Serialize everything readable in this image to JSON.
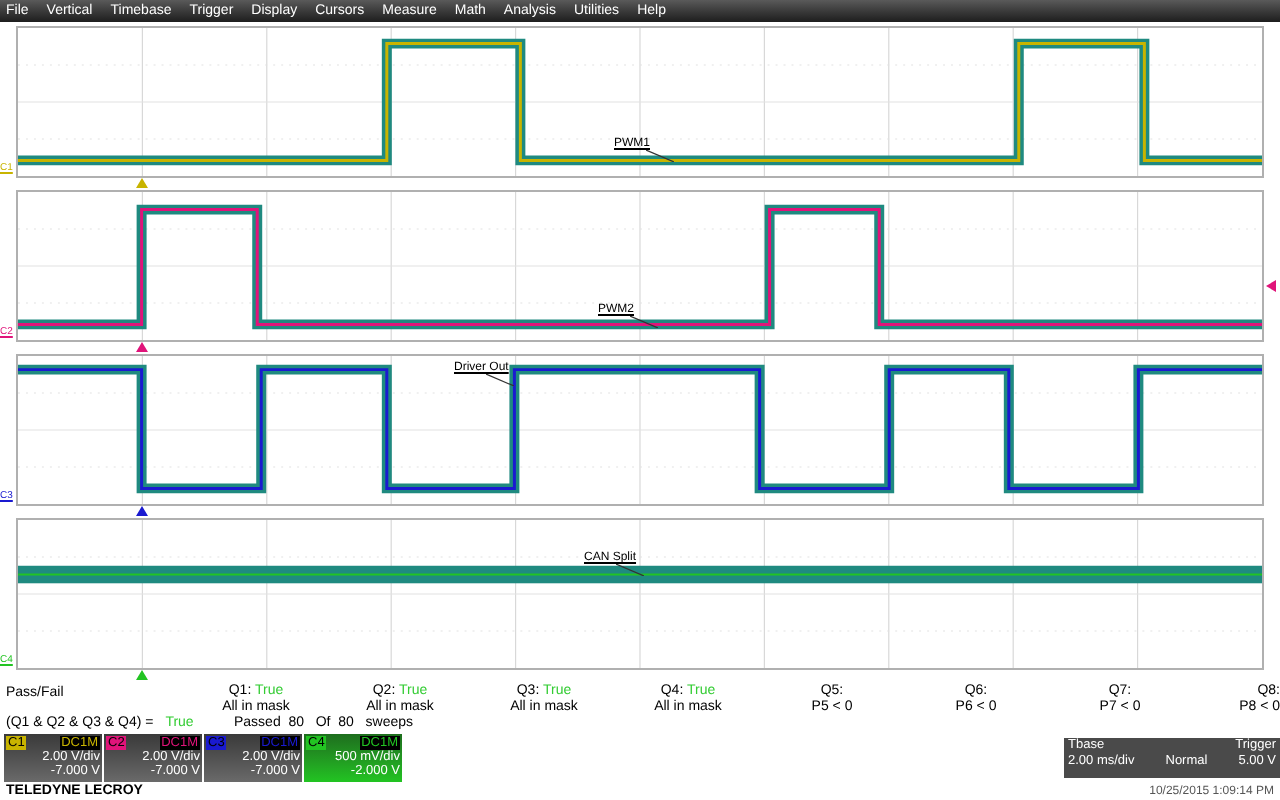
{
  "menu": [
    "File",
    "Vertical",
    "Timebase",
    "Trigger",
    "Display",
    "Cursors",
    "Measure",
    "Math",
    "Analysis",
    "Utilities",
    "Help"
  ],
  "traces": [
    {
      "marker": "C1",
      "label": "PWM1"
    },
    {
      "marker": "C2",
      "label": "PWM2"
    },
    {
      "marker": "C3",
      "label": "Driver Out"
    },
    {
      "marker": "C4",
      "label": "CAN Split"
    }
  ],
  "pass_fail": {
    "title": "Pass/Fail",
    "tests": [
      {
        "label": "Q1:",
        "result": "True",
        "detail": "All in mask"
      },
      {
        "label": "Q2:",
        "result": "True",
        "detail": "All in mask"
      },
      {
        "label": "Q3:",
        "result": "True",
        "detail": "All in mask"
      },
      {
        "label": "Q4:",
        "result": "True",
        "detail": "All in mask"
      },
      {
        "label": "Q5:",
        "detail": "P5 < 0"
      },
      {
        "label": "Q6:",
        "detail": "P6 < 0"
      },
      {
        "label": "Q7:",
        "detail": "P7 < 0"
      },
      {
        "label": "Q8:",
        "detail": "P8 < 0"
      }
    ],
    "expression": "(Q1 & Q2 & Q3 & Q4) =",
    "expression_result": "True",
    "summary": "Passed  80   Of  80   sweeps"
  },
  "channels": [
    {
      "name": "C1",
      "coupling": "DC1M",
      "scale": "2.00 V/div",
      "offset": "-7.000 V",
      "color": "#c8b400",
      "selected": false
    },
    {
      "name": "C2",
      "coupling": "DC1M",
      "scale": "2.00 V/div",
      "offset": "-7.000 V",
      "color": "#e0147a",
      "selected": false
    },
    {
      "name": "C3",
      "coupling": "DC1M",
      "scale": "2.00 V/div",
      "offset": "-7.000 V",
      "color": "#1a1ad0",
      "selected": false
    },
    {
      "name": "C4",
      "coupling": "DC1M",
      "scale": "500 mV/div",
      "offset": "-2.000 V",
      "color": "#22c422",
      "selected": true
    }
  ],
  "brand": "TELEDYNE LECROY",
  "timebase": {
    "title": "Tbase",
    "trigger_title": "Trigger",
    "scale": "2.00 ms/div",
    "mode": "Normal",
    "level": "5.00 V"
  },
  "timestamp": "10/25/2015 1:09:14 PM"
}
